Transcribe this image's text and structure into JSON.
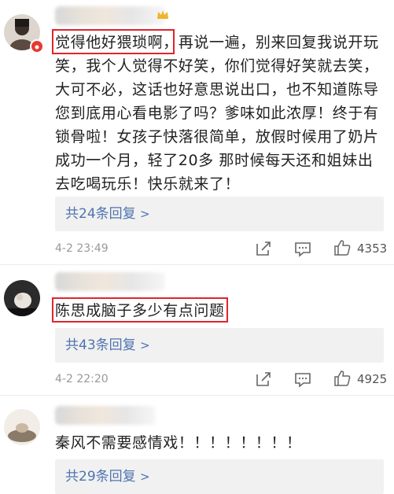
{
  "comments": [
    {
      "text_line1_highlight": "觉得他好猥琐啊，",
      "text_line1_rest": "再说一遍，别来回复我说开玩",
      "text_lines": [
        "笑，我个人觉得不好笑，你们觉得好笑就去笑，",
        "大可不必，这话也好意思说出口，也不知道陈导",
        "您到底用心看电影了吗？爹味如此浓厚！终于有",
        "锁骨啦！女孩子快落很简单，放假时候用了奶片",
        "成功一个月，轻了20多 那时候每天还和姐妹出",
        "去吃喝玩乐！快乐就来了！"
      ],
      "replies": "共24条回复",
      "chevron": ">",
      "timestamp": "4-2 23:49",
      "likes": "4353"
    },
    {
      "text_highlight": "陈思成脑子多少有点问题",
      "replies": "共43条回复",
      "chevron": ">",
      "timestamp": "4-2 22:20",
      "likes": "4925"
    },
    {
      "text": "秦风不需要感情戏！！！！！！！！",
      "replies": "共29条回复",
      "chevron": ">"
    }
  ],
  "colors": {
    "highlight_border": "#e0242c",
    "reply_link": "#4e74b0",
    "reply_bg": "#f1f1f1",
    "meta": "#999999"
  },
  "icons": [
    "share-icon",
    "comment-icon",
    "like-icon",
    "verified-badge-icon",
    "chevron-right-icon"
  ]
}
